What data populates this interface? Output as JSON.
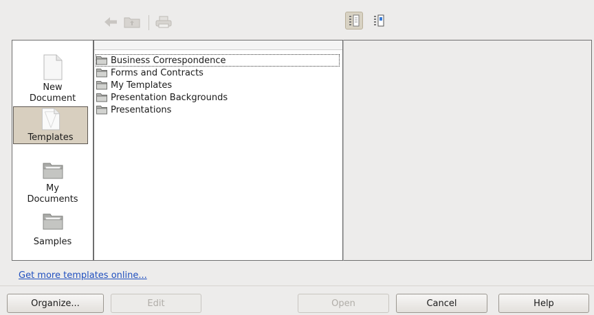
{
  "toolbar": {
    "back_icon": "back-arrow-icon",
    "up_folder_icon": "folder-up-icon",
    "print_icon": "print-icon",
    "view_large_icon": "large-icons-view-icon",
    "view_details_icon": "detail-list-view-icon"
  },
  "sidebar": {
    "items": [
      {
        "label": "New Document",
        "icon": "new-document-icon",
        "selected": false
      },
      {
        "label": "Templates",
        "icon": "templates-icon",
        "selected": true
      },
      {
        "label": "My Documents",
        "icon": "folder-icon",
        "selected": false
      },
      {
        "label": "Samples",
        "icon": "folder-icon",
        "selected": false
      }
    ]
  },
  "file_list": {
    "items": [
      {
        "label": "Business Correspondence",
        "icon": "folder-icon",
        "focused": true
      },
      {
        "label": "Forms and Contracts",
        "icon": "folder-icon",
        "focused": false
      },
      {
        "label": "My Templates",
        "icon": "folder-icon",
        "focused": false
      },
      {
        "label": "Presentation Backgrounds",
        "icon": "folder-icon",
        "focused": false
      },
      {
        "label": "Presentations",
        "icon": "folder-icon",
        "focused": false
      }
    ]
  },
  "link": {
    "label": "Get more templates online..."
  },
  "buttons": {
    "organize": {
      "label": "Organize...",
      "enabled": true
    },
    "edit": {
      "label": "Edit",
      "enabled": false
    },
    "open": {
      "label": "Open",
      "enabled": false
    },
    "cancel": {
      "label": "Cancel",
      "enabled": true
    },
    "help": {
      "label": "Help",
      "enabled": true
    }
  },
  "colors": {
    "background": "#edeceb",
    "selection": "#d8cfbf",
    "link": "#1f4fbf"
  }
}
